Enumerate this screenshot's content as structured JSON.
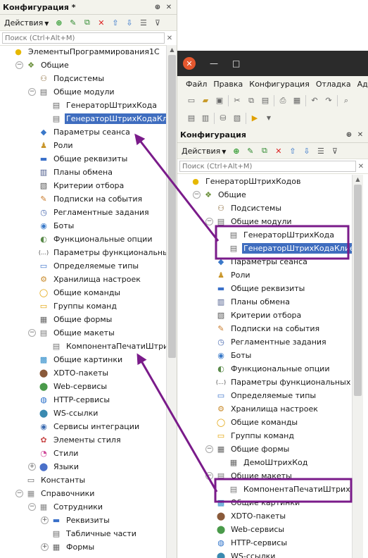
{
  "left": {
    "title": "Конфигурация *",
    "actions_label": "Действия",
    "search_placeholder": "Поиск (Ctrl+Alt+M)",
    "items": [
      {
        "label": "ЭлементыПрограммирования1С",
        "icon": "config-root-icon",
        "level": 0,
        "exp": ""
      },
      {
        "label": "Общие",
        "icon": "common-icon",
        "level": 1,
        "exp": "−"
      },
      {
        "label": "Подсистемы",
        "icon": "subsystems-icon",
        "level": 2,
        "exp": ""
      },
      {
        "label": "Общие модули",
        "icon": "module-icon",
        "level": 2,
        "exp": "−"
      },
      {
        "label": "ГенераторШтрихКода",
        "icon": "module-icon",
        "level": 3,
        "exp": ""
      },
      {
        "label": "ГенераторШтрихКодаКлиент",
        "icon": "module-icon",
        "level": 3,
        "exp": "",
        "selected": true
      },
      {
        "label": "Параметры сеанса",
        "icon": "session-params-icon",
        "level": 2,
        "exp": ""
      },
      {
        "label": "Роли",
        "icon": "roles-icon",
        "level": 2,
        "exp": ""
      },
      {
        "label": "Общие реквизиты",
        "icon": "attributes-icon",
        "level": 2,
        "exp": ""
      },
      {
        "label": "Планы обмена",
        "icon": "exchange-plans-icon",
        "level": 2,
        "exp": ""
      },
      {
        "label": "Критерии отбора",
        "icon": "filter-criteria-icon",
        "level": 2,
        "exp": ""
      },
      {
        "label": "Подписки на события",
        "icon": "event-subscriptions-icon",
        "level": 2,
        "exp": ""
      },
      {
        "label": "Регламентные задания",
        "icon": "scheduled-jobs-icon",
        "level": 2,
        "exp": ""
      },
      {
        "label": "Боты",
        "icon": "bots-icon",
        "level": 2,
        "exp": ""
      },
      {
        "label": "Функциональные опции",
        "icon": "functional-options-icon",
        "level": 2,
        "exp": ""
      },
      {
        "label": "Параметры функциональных опций",
        "icon": "fo-params-icon",
        "level": 2,
        "exp": ""
      },
      {
        "label": "Определяемые типы",
        "icon": "defined-types-icon",
        "level": 2,
        "exp": ""
      },
      {
        "label": "Хранилища настроек",
        "icon": "settings-storage-icon",
        "level": 2,
        "exp": ""
      },
      {
        "label": "Общие команды",
        "icon": "commands-icon",
        "level": 2,
        "exp": ""
      },
      {
        "label": "Группы команд",
        "icon": "command-groups-icon",
        "level": 2,
        "exp": ""
      },
      {
        "label": "Общие формы",
        "icon": "forms-icon",
        "level": 2,
        "exp": ""
      },
      {
        "label": "Общие макеты",
        "icon": "templates-icon",
        "level": 2,
        "exp": "−"
      },
      {
        "label": "КомпонентаПечатиШтрихкодов",
        "icon": "template-icon",
        "level": 3,
        "exp": ""
      },
      {
        "label": "Общие картинки",
        "icon": "pictures-icon",
        "level": 2,
        "exp": ""
      },
      {
        "label": "XDTO-пакеты",
        "icon": "xdto-icon",
        "level": 2,
        "exp": ""
      },
      {
        "label": "Web-сервисы",
        "icon": "web-services-icon",
        "level": 2,
        "exp": ""
      },
      {
        "label": "HTTP-сервисы",
        "icon": "http-services-icon",
        "level": 2,
        "exp": ""
      },
      {
        "label": "WS-ссылки",
        "icon": "ws-links-icon",
        "level": 2,
        "exp": ""
      },
      {
        "label": "Сервисы интеграции",
        "icon": "integration-services-icon",
        "level": 2,
        "exp": ""
      },
      {
        "label": "Элементы стиля",
        "icon": "style-items-icon",
        "level": 2,
        "exp": ""
      },
      {
        "label": "Стили",
        "icon": "styles-icon",
        "level": 2,
        "exp": ""
      },
      {
        "label": "Языки",
        "icon": "languages-icon",
        "level": 2,
        "exp": "+"
      },
      {
        "label": "Константы",
        "icon": "constants-icon",
        "level": 1,
        "exp": ""
      },
      {
        "label": "Справочники",
        "icon": "catalogs-icon",
        "level": 1,
        "exp": "−"
      },
      {
        "label": "Сотрудники",
        "icon": "catalog-icon",
        "level": 2,
        "exp": "−"
      },
      {
        "label": "Реквизиты",
        "icon": "attributes-icon",
        "level": 3,
        "exp": "+"
      },
      {
        "label": "Табличные части",
        "icon": "tabular-sections-icon",
        "level": 3,
        "exp": ""
      },
      {
        "label": "Формы",
        "icon": "forms-icon",
        "level": 3,
        "exp": "+"
      }
    ]
  },
  "right": {
    "menu": [
      "Файл",
      "Правка",
      "Конфигурация",
      "Отладка",
      "Админ"
    ],
    "panel_title": "Конфигурация",
    "actions_label": "Действия",
    "search_placeholder": "Поиск (Ctrl+Alt+M)",
    "items": [
      {
        "label": "ГенераторШтрихКодов",
        "icon": "config-root-icon",
        "level": 0,
        "exp": ""
      },
      {
        "label": "Общие",
        "icon": "common-icon",
        "level": 1,
        "exp": "−"
      },
      {
        "label": "Подсистемы",
        "icon": "subsystems-icon",
        "level": 2,
        "exp": ""
      },
      {
        "label": "Общие модули",
        "icon": "module-icon",
        "level": 2,
        "exp": "−"
      },
      {
        "label": "ГенераторШтрихКода",
        "icon": "module-icon",
        "level": 3,
        "exp": ""
      },
      {
        "label": "ГенераторШтрихКодаКлиент",
        "icon": "module-icon",
        "level": 3,
        "exp": "",
        "selected": true
      },
      {
        "label": "Параметры сеанса",
        "icon": "session-params-icon",
        "level": 2,
        "exp": ""
      },
      {
        "label": "Роли",
        "icon": "roles-icon",
        "level": 2,
        "exp": ""
      },
      {
        "label": "Общие реквизиты",
        "icon": "attributes-icon",
        "level": 2,
        "exp": ""
      },
      {
        "label": "Планы обмена",
        "icon": "exchange-plans-icon",
        "level": 2,
        "exp": ""
      },
      {
        "label": "Критерии отбора",
        "icon": "filter-criteria-icon",
        "level": 2,
        "exp": ""
      },
      {
        "label": "Подписки на события",
        "icon": "event-subscriptions-icon",
        "level": 2,
        "exp": ""
      },
      {
        "label": "Регламентные задания",
        "icon": "scheduled-jobs-icon",
        "level": 2,
        "exp": ""
      },
      {
        "label": "Боты",
        "icon": "bots-icon",
        "level": 2,
        "exp": ""
      },
      {
        "label": "Функциональные опции",
        "icon": "functional-options-icon",
        "level": 2,
        "exp": ""
      },
      {
        "label": "Параметры функциональных опций",
        "icon": "fo-params-icon",
        "level": 2,
        "exp": ""
      },
      {
        "label": "Определяемые типы",
        "icon": "defined-types-icon",
        "level": 2,
        "exp": ""
      },
      {
        "label": "Хранилища настроек",
        "icon": "settings-storage-icon",
        "level": 2,
        "exp": ""
      },
      {
        "label": "Общие команды",
        "icon": "commands-icon",
        "level": 2,
        "exp": ""
      },
      {
        "label": "Группы команд",
        "icon": "command-groups-icon",
        "level": 2,
        "exp": ""
      },
      {
        "label": "Общие формы",
        "icon": "forms-icon",
        "level": 2,
        "exp": "−"
      },
      {
        "label": "ДемоШтрихКод",
        "icon": "form-icon",
        "level": 3,
        "exp": ""
      },
      {
        "label": "Общие макеты",
        "icon": "templates-icon",
        "level": 2,
        "exp": "−"
      },
      {
        "label": "КомпонентаПечатиШтрихкодов",
        "icon": "template-icon",
        "level": 3,
        "exp": ""
      },
      {
        "label": "Общие картинки",
        "icon": "pictures-icon",
        "level": 2,
        "exp": ""
      },
      {
        "label": "XDTO-пакеты",
        "icon": "xdto-icon",
        "level": 2,
        "exp": ""
      },
      {
        "label": "Web-сервисы",
        "icon": "web-services-icon",
        "level": 2,
        "exp": ""
      },
      {
        "label": "HTTP-сервисы",
        "icon": "http-services-icon",
        "level": 2,
        "exp": ""
      },
      {
        "label": "WS-ссылки",
        "icon": "ws-links-icon",
        "level": 2,
        "exp": ""
      }
    ]
  },
  "colors": {
    "selection": "#3f6dbf",
    "annotation": "#7a1b8a",
    "dark_title": "#2b2b2b",
    "close_button": "#e4572e"
  }
}
